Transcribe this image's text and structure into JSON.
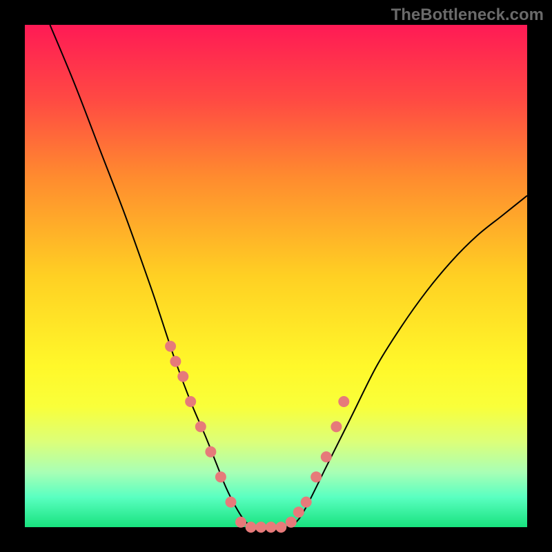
{
  "watermark": "TheBottleneck.com",
  "chart_data": {
    "type": "line",
    "title": "",
    "xlabel": "",
    "ylabel": "",
    "xlim": [
      0,
      100
    ],
    "ylim": [
      0,
      100
    ],
    "series": [
      {
        "name": "curve",
        "x": [
          5,
          10,
          15,
          20,
          25,
          27,
          30,
          33,
          36,
          38,
          40,
          42,
          44,
          46,
          48,
          50,
          52,
          54,
          56,
          60,
          65,
          70,
          75,
          80,
          85,
          90,
          95,
          100
        ],
        "y": [
          100,
          88,
          75,
          62,
          48,
          42,
          33,
          25,
          18,
          13,
          8,
          4,
          1,
          0,
          0,
          0,
          0,
          1,
          4,
          12,
          22,
          32,
          40,
          47,
          53,
          58,
          62,
          66
        ]
      }
    ],
    "markers": {
      "name": "dots",
      "x": [
        29,
        30,
        31.5,
        33,
        35,
        37,
        39,
        41,
        43,
        45,
        47,
        49,
        51,
        53,
        54.5,
        56,
        58,
        60,
        62,
        63.5
      ],
      "y": [
        36,
        33,
        30,
        25,
        20,
        15,
        10,
        5,
        1,
        0,
        0,
        0,
        0,
        1,
        3,
        5,
        10,
        14,
        20,
        25
      ]
    }
  }
}
